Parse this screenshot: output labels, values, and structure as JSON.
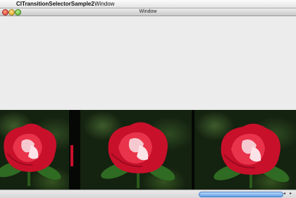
{
  "menubar": {
    "apple_glyph": "",
    "app_name": "CITransitionSelectorSample2",
    "menu_window": "Window"
  },
  "window": {
    "title": "Window"
  },
  "icons": {
    "close": "close-button",
    "minimize": "minimize-button",
    "zoom": "zoom-button",
    "scroll_left": "◂",
    "scroll_right": "▸"
  },
  "colors": {
    "rose": "#d6142a",
    "foliage": "#2f4a22",
    "scroll_thumb": "#5e9fe8"
  }
}
